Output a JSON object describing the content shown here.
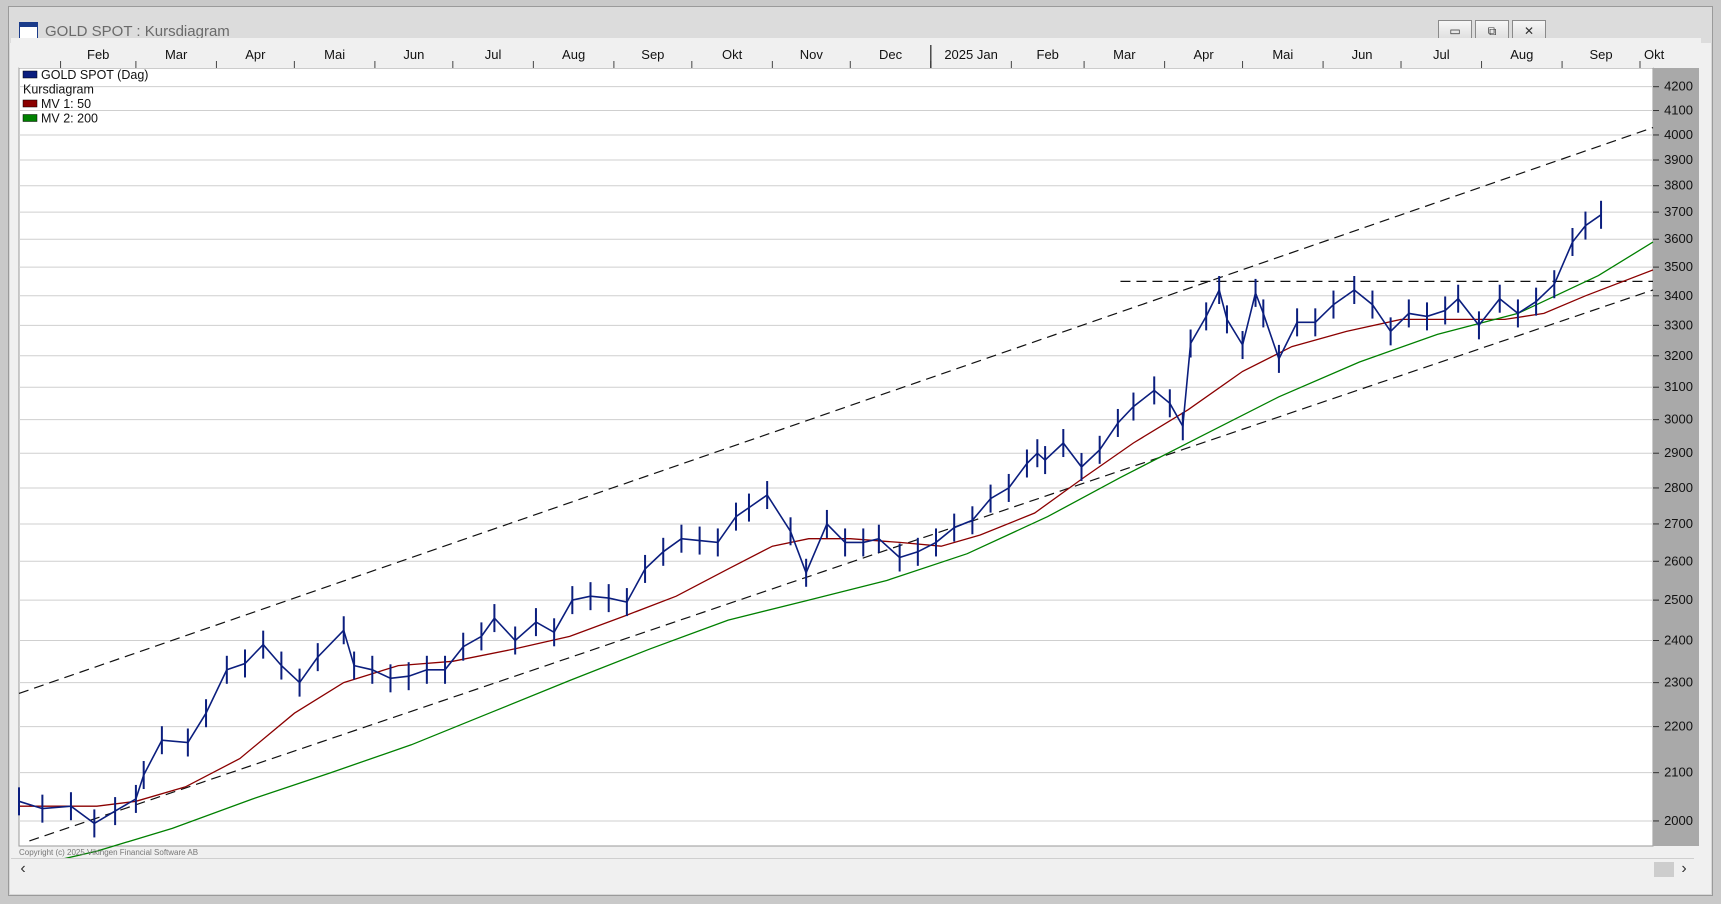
{
  "window": {
    "title": "GOLD SPOT : Kursdiagram",
    "buttons": {
      "minimize": "▭",
      "restore": "⧉",
      "close": "✕"
    }
  },
  "chart_data": {
    "type": "line",
    "title": "",
    "ylim": [
      1950,
      4280
    ],
    "y_ticks": [
      2000,
      2100,
      2200,
      2300,
      2400,
      2500,
      2600,
      2700,
      2800,
      2900,
      3000,
      3100,
      3200,
      3300,
      3400,
      3500,
      3600,
      3700,
      3800,
      3900,
      4000,
      4100,
      4200
    ],
    "y_scale": "log",
    "grid": true,
    "xlim": [
      "2024-01-16",
      "2025-10-06"
    ],
    "x_ticks": [
      {
        "label": "Feb",
        "date": "2024-02-01"
      },
      {
        "label": "Mar",
        "date": "2024-03-01"
      },
      {
        "label": "Apr",
        "date": "2024-04-01"
      },
      {
        "label": "Mai",
        "date": "2024-05-01"
      },
      {
        "label": "Jun",
        "date": "2024-06-01"
      },
      {
        "label": "Jul",
        "date": "2024-07-01"
      },
      {
        "label": "Aug",
        "date": "2024-08-01"
      },
      {
        "label": "Sep",
        "date": "2024-09-01"
      },
      {
        "label": "Okt",
        "date": "2024-10-01"
      },
      {
        "label": "Nov",
        "date": "2024-11-01"
      },
      {
        "label": "Dec",
        "date": "2024-12-01"
      },
      {
        "label": "2025 Jan",
        "date": "2025-01-01"
      },
      {
        "label": "Feb",
        "date": "2025-02-01"
      },
      {
        "label": "Mar",
        "date": "2025-03-01"
      },
      {
        "label": "Apr",
        "date": "2025-04-01"
      },
      {
        "label": "Mai",
        "date": "2025-05-01"
      },
      {
        "label": "Jun",
        "date": "2025-06-01"
      },
      {
        "label": "Jul",
        "date": "2025-07-01"
      },
      {
        "label": "Aug",
        "date": "2025-08-01"
      },
      {
        "label": "Sep",
        "date": "2025-09-01"
      },
      {
        "label": "Okt",
        "date": "2025-10-01"
      }
    ],
    "legend": {
      "placement": "top-left",
      "entries": [
        {
          "label": "GOLD SPOT (Dag)",
          "color": "#0b1e7e"
        },
        {
          "label": "Kursdiagram",
          "color": ""
        },
        {
          "label": "MV 1: 50",
          "color": "#8b0000"
        },
        {
          "label": "MV 2: 200",
          "color": "#008000"
        }
      ]
    },
    "series": [
      {
        "name": "GOLD SPOT (Dag)",
        "style": "bars",
        "color": "#0b1e7e",
        "x": [
          "2024-01-16",
          "2024-01-25",
          "2024-02-05",
          "2024-02-14",
          "2024-02-22",
          "2024-03-01",
          "2024-03-04",
          "2024-03-11",
          "2024-03-21",
          "2024-03-28",
          "2024-04-05",
          "2024-04-12",
          "2024-04-19",
          "2024-04-26",
          "2024-05-03",
          "2024-05-10",
          "2024-05-20",
          "2024-05-24",
          "2024-05-31",
          "2024-06-07",
          "2024-06-14",
          "2024-06-21",
          "2024-06-28",
          "2024-07-05",
          "2024-07-12",
          "2024-07-17",
          "2024-07-25",
          "2024-08-02",
          "2024-08-09",
          "2024-08-16",
          "2024-08-23",
          "2024-08-30",
          "2024-09-06",
          "2024-09-13",
          "2024-09-20",
          "2024-09-27",
          "2024-10-04",
          "2024-10-11",
          "2024-10-18",
          "2024-10-23",
          "2024-10-30",
          "2024-11-08",
          "2024-11-14",
          "2024-11-22",
          "2024-11-29",
          "2024-12-06",
          "2024-12-12",
          "2024-12-20",
          "2024-12-27",
          "2025-01-03",
          "2025-01-10",
          "2025-01-17",
          "2025-01-24",
          "2025-01-31",
          "2025-02-07",
          "2025-02-11",
          "2025-02-14",
          "2025-02-21",
          "2025-02-28",
          "2025-03-07",
          "2025-03-14",
          "2025-03-20",
          "2025-03-28",
          "2025-04-03",
          "2025-04-08",
          "2025-04-11",
          "2025-04-17",
          "2025-04-22",
          "2025-04-25",
          "2025-05-01",
          "2025-05-06",
          "2025-05-09",
          "2025-05-15",
          "2025-05-22",
          "2025-05-29",
          "2025-06-05",
          "2025-06-13",
          "2025-06-20",
          "2025-06-27",
          "2025-07-04",
          "2025-07-11",
          "2025-07-18",
          "2025-07-23",
          "2025-07-31",
          "2025-08-08",
          "2025-08-15",
          "2025-08-22",
          "2025-08-29",
          "2025-09-05",
          "2025-09-10",
          "2025-09-16"
        ],
        "values": [
          2040,
          2025,
          2030,
          1995,
          2020,
          2045,
          2095,
          2170,
          2165,
          2230,
          2330,
          2345,
          2390,
          2340,
          2300,
          2360,
          2425,
          2340,
          2330,
          2310,
          2315,
          2330,
          2330,
          2385,
          2410,
          2455,
          2400,
          2445,
          2420,
          2500,
          2510,
          2505,
          2495,
          2580,
          2625,
          2660,
          2655,
          2650,
          2720,
          2745,
          2780,
          2680,
          2570,
          2700,
          2650,
          2650,
          2660,
          2610,
          2625,
          2650,
          2690,
          2710,
          2770,
          2800,
          2870,
          2900,
          2880,
          2930,
          2860,
          2910,
          2990,
          3040,
          3090,
          3050,
          2980,
          3240,
          3330,
          3420,
          3320,
          3235,
          3410,
          3340,
          3190,
          3310,
          3310,
          3370,
          3420,
          3370,
          3280,
          3340,
          3330,
          3350,
          3390,
          3300,
          3390,
          3340,
          3380,
          3440,
          3590,
          3650,
          3690
        ]
      },
      {
        "name": "MV 1: 50",
        "style": "line",
        "color": "#8b0000",
        "x": [
          "2024-01-16",
          "2024-02-15",
          "2024-03-01",
          "2024-03-20",
          "2024-04-10",
          "2024-05-01",
          "2024-05-20",
          "2024-06-10",
          "2024-07-01",
          "2024-07-25",
          "2024-08-15",
          "2024-09-05",
          "2024-09-25",
          "2024-10-15",
          "2024-11-01",
          "2024-11-15",
          "2024-12-01",
          "2024-12-20",
          "2025-01-05",
          "2025-01-20",
          "2025-02-10",
          "2025-03-01",
          "2025-03-20",
          "2025-04-10",
          "2025-05-01",
          "2025-05-20",
          "2025-06-10",
          "2025-07-01",
          "2025-07-20",
          "2025-08-10",
          "2025-08-25",
          "2025-09-10",
          "2025-10-06"
        ],
        "values": [
          2030,
          2030,
          2040,
          2070,
          2130,
          2230,
          2300,
          2340,
          2350,
          2380,
          2410,
          2460,
          2510,
          2580,
          2640,
          2660,
          2660,
          2650,
          2640,
          2670,
          2730,
          2830,
          2930,
          3030,
          3150,
          3230,
          3280,
          3320,
          3320,
          3320,
          3340,
          3400,
          3490
        ]
      },
      {
        "name": "MV 2: 200",
        "style": "line",
        "color": "#008000",
        "x": [
          "2024-01-16",
          "2024-02-15",
          "2024-03-15",
          "2024-04-15",
          "2024-05-15",
          "2024-06-15",
          "2024-07-15",
          "2024-08-15",
          "2024-09-15",
          "2024-10-15",
          "2024-11-15",
          "2024-12-15",
          "2025-01-15",
          "2025-02-15",
          "2025-03-15",
          "2025-04-15",
          "2025-05-15",
          "2025-06-15",
          "2025-07-15",
          "2025-08-15",
          "2025-09-15",
          "2025-10-06"
        ],
        "values": [
          1905,
          1940,
          1985,
          2045,
          2100,
          2160,
          2230,
          2305,
          2380,
          2450,
          2500,
          2550,
          2620,
          2720,
          2830,
          2950,
          3070,
          3180,
          3270,
          3340,
          3470,
          3590
        ]
      }
    ],
    "annotations": [
      {
        "type": "trendline",
        "style": "dashed",
        "from": [
          "2024-01-16",
          2275
        ],
        "to": [
          "2025-10-06",
          4030
        ]
      },
      {
        "type": "trendline",
        "style": "dashed",
        "from": [
          "2024-01-20",
          1960
        ],
        "to": [
          "2025-10-06",
          3420
        ]
      },
      {
        "type": "hline",
        "style": "dashed",
        "from": [
          "2025-03-15",
          3450
        ],
        "to": [
          "2025-10-06",
          3450
        ]
      }
    ],
    "copyright": "Copyright (c) 2025 Vikingen Financial Software AB"
  }
}
